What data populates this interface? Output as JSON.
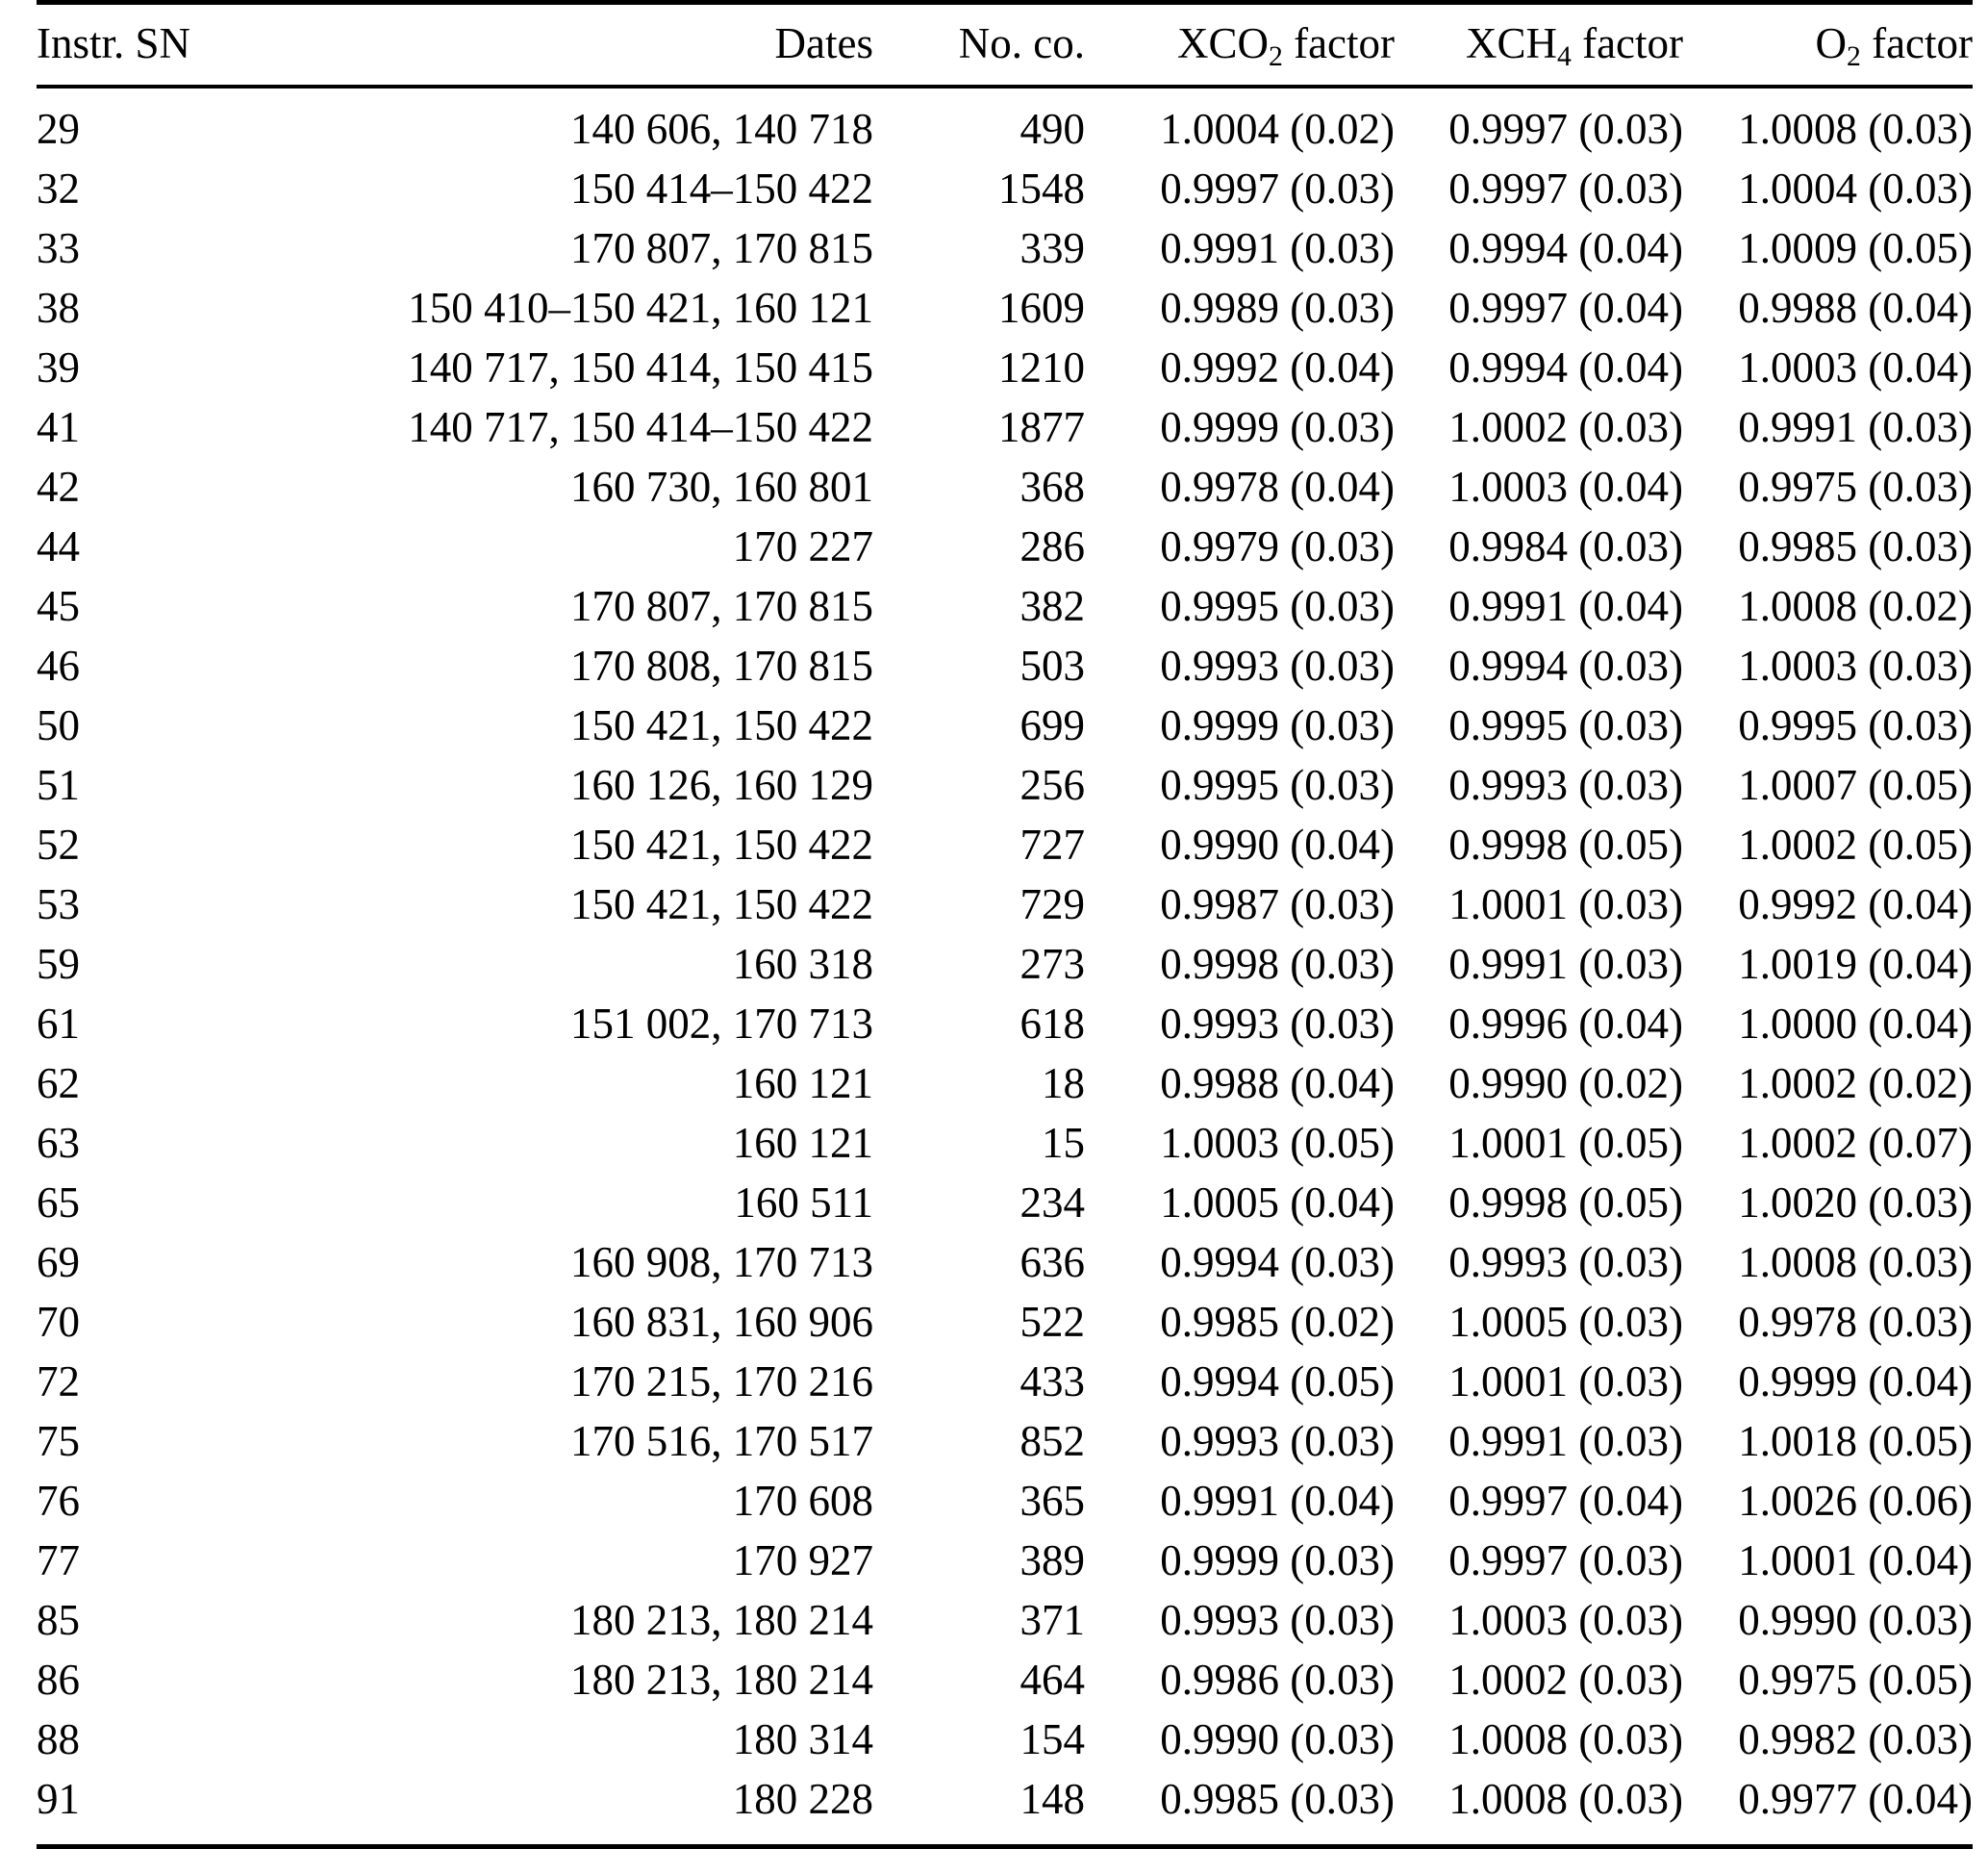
{
  "table": {
    "columns": [
      {
        "key": "sn",
        "label": "Instr. SN",
        "align": "left"
      },
      {
        "key": "dates",
        "label": "Dates",
        "align": "right"
      },
      {
        "key": "noco",
        "label": "No. co.",
        "align": "right"
      },
      {
        "key": "xco2",
        "label_prefix": "XCO",
        "label_sub": "2",
        "label_suffix": " factor",
        "align": "right"
      },
      {
        "key": "xch4",
        "label_prefix": "XCH",
        "label_sub": "4",
        "label_suffix": " factor",
        "align": "right"
      },
      {
        "key": "o2",
        "label_prefix": "O",
        "label_sub": "2",
        "label_suffix": " factor",
        "align": "right"
      }
    ],
    "headers": {
      "sn": "Instr. SN",
      "dates": "Dates",
      "noco": "No. co.",
      "xco2_prefix": "XCO",
      "xco2_sub": "2",
      "xco2_suffix": " factor",
      "xch4_prefix": "XCH",
      "xch4_sub": "4",
      "xch4_suffix": " factor",
      "o2_prefix": "O",
      "o2_sub": "2",
      "o2_suffix": " factor"
    },
    "rows": [
      {
        "sn": "29",
        "dates": "140 606, 140 718",
        "noco": "490",
        "xco2": "1.0004 (0.02)",
        "xch4": "0.9997 (0.03)",
        "o2": "1.0008 (0.03)"
      },
      {
        "sn": "32",
        "dates": "150 414–150 422",
        "noco": "1548",
        "xco2": "0.9997 (0.03)",
        "xch4": "0.9997 (0.03)",
        "o2": "1.0004 (0.03)"
      },
      {
        "sn": "33",
        "dates": "170 807, 170 815",
        "noco": "339",
        "xco2": "0.9991 (0.03)",
        "xch4": "0.9994 (0.04)",
        "o2": "1.0009 (0.05)"
      },
      {
        "sn": "38",
        "dates": "150 410–150 421, 160 121",
        "noco": "1609",
        "xco2": "0.9989 (0.03)",
        "xch4": "0.9997 (0.04)",
        "o2": "0.9988 (0.04)"
      },
      {
        "sn": "39",
        "dates": "140 717, 150 414, 150 415",
        "noco": "1210",
        "xco2": "0.9992 (0.04)",
        "xch4": "0.9994 (0.04)",
        "o2": "1.0003 (0.04)"
      },
      {
        "sn": "41",
        "dates": "140 717, 150 414–150 422",
        "noco": "1877",
        "xco2": "0.9999 (0.03)",
        "xch4": "1.0002 (0.03)",
        "o2": "0.9991 (0.03)"
      },
      {
        "sn": "42",
        "dates": "160 730, 160 801",
        "noco": "368",
        "xco2": "0.9978 (0.04)",
        "xch4": "1.0003 (0.04)",
        "o2": "0.9975 (0.03)"
      },
      {
        "sn": "44",
        "dates": "170 227",
        "noco": "286",
        "xco2": "0.9979 (0.03)",
        "xch4": "0.9984 (0.03)",
        "o2": "0.9985 (0.03)"
      },
      {
        "sn": "45",
        "dates": "170 807, 170 815",
        "noco": "382",
        "xco2": "0.9995 (0.03)",
        "xch4": "0.9991 (0.04)",
        "o2": "1.0008 (0.02)"
      },
      {
        "sn": "46",
        "dates": "170 808, 170 815",
        "noco": "503",
        "xco2": "0.9993 (0.03)",
        "xch4": "0.9994 (0.03)",
        "o2": "1.0003 (0.03)"
      },
      {
        "sn": "50",
        "dates": "150 421, 150 422",
        "noco": "699",
        "xco2": "0.9999 (0.03)",
        "xch4": "0.9995 (0.03)",
        "o2": "0.9995 (0.03)"
      },
      {
        "sn": "51",
        "dates": "160 126, 160 129",
        "noco": "256",
        "xco2": "0.9995 (0.03)",
        "xch4": "0.9993 (0.03)",
        "o2": "1.0007 (0.05)"
      },
      {
        "sn": "52",
        "dates": "150 421, 150 422",
        "noco": "727",
        "xco2": "0.9990 (0.04)",
        "xch4": "0.9998 (0.05)",
        "o2": "1.0002 (0.05)"
      },
      {
        "sn": "53",
        "dates": "150 421, 150 422",
        "noco": "729",
        "xco2": "0.9987 (0.03)",
        "xch4": "1.0001 (0.03)",
        "o2": "0.9992 (0.04)"
      },
      {
        "sn": "59",
        "dates": "160 318",
        "noco": "273",
        "xco2": "0.9998 (0.03)",
        "xch4": "0.9991 (0.03)",
        "o2": "1.0019 (0.04)"
      },
      {
        "sn": "61",
        "dates": "151 002, 170 713",
        "noco": "618",
        "xco2": "0.9993 (0.03)",
        "xch4": "0.9996 (0.04)",
        "o2": "1.0000 (0.04)"
      },
      {
        "sn": "62",
        "dates": "160 121",
        "noco": "18",
        "xco2": "0.9988 (0.04)",
        "xch4": "0.9990 (0.02)",
        "o2": "1.0002 (0.02)"
      },
      {
        "sn": "63",
        "dates": "160 121",
        "noco": "15",
        "xco2": "1.0003 (0.05)",
        "xch4": "1.0001 (0.05)",
        "o2": "1.0002 (0.07)"
      },
      {
        "sn": "65",
        "dates": "160 511",
        "noco": "234",
        "xco2": "1.0005 (0.04)",
        "xch4": "0.9998 (0.05)",
        "o2": "1.0020 (0.03)"
      },
      {
        "sn": "69",
        "dates": "160 908, 170 713",
        "noco": "636",
        "xco2": "0.9994 (0.03)",
        "xch4": "0.9993 (0.03)",
        "o2": "1.0008 (0.03)"
      },
      {
        "sn": "70",
        "dates": "160 831, 160 906",
        "noco": "522",
        "xco2": "0.9985 (0.02)",
        "xch4": "1.0005 (0.03)",
        "o2": "0.9978 (0.03)"
      },
      {
        "sn": "72",
        "dates": "170 215, 170 216",
        "noco": "433",
        "xco2": "0.9994 (0.05)",
        "xch4": "1.0001 (0.03)",
        "o2": "0.9999 (0.04)"
      },
      {
        "sn": "75",
        "dates": "170 516, 170 517",
        "noco": "852",
        "xco2": "0.9993 (0.03)",
        "xch4": "0.9991 (0.03)",
        "o2": "1.0018 (0.05)"
      },
      {
        "sn": "76",
        "dates": "170 608",
        "noco": "365",
        "xco2": "0.9991 (0.04)",
        "xch4": "0.9997 (0.04)",
        "o2": "1.0026 (0.06)"
      },
      {
        "sn": "77",
        "dates": "170 927",
        "noco": "389",
        "xco2": "0.9999 (0.03)",
        "xch4": "0.9997 (0.03)",
        "o2": "1.0001 (0.04)"
      },
      {
        "sn": "85",
        "dates": "180 213, 180 214",
        "noco": "371",
        "xco2": "0.9993 (0.03)",
        "xch4": "1.0003 (0.03)",
        "o2": "0.9990 (0.03)"
      },
      {
        "sn": "86",
        "dates": "180 213, 180 214",
        "noco": "464",
        "xco2": "0.9986 (0.03)",
        "xch4": "1.0002 (0.03)",
        "o2": "0.9975 (0.05)"
      },
      {
        "sn": "88",
        "dates": "180 314",
        "noco": "154",
        "xco2": "0.9990 (0.03)",
        "xch4": "1.0008 (0.03)",
        "o2": "0.9982 (0.03)"
      },
      {
        "sn": "91",
        "dates": "180 228",
        "noco": "148",
        "xco2": "0.9985 (0.03)",
        "xch4": "1.0008 (0.03)",
        "o2": "0.9977 (0.04)"
      }
    ]
  }
}
